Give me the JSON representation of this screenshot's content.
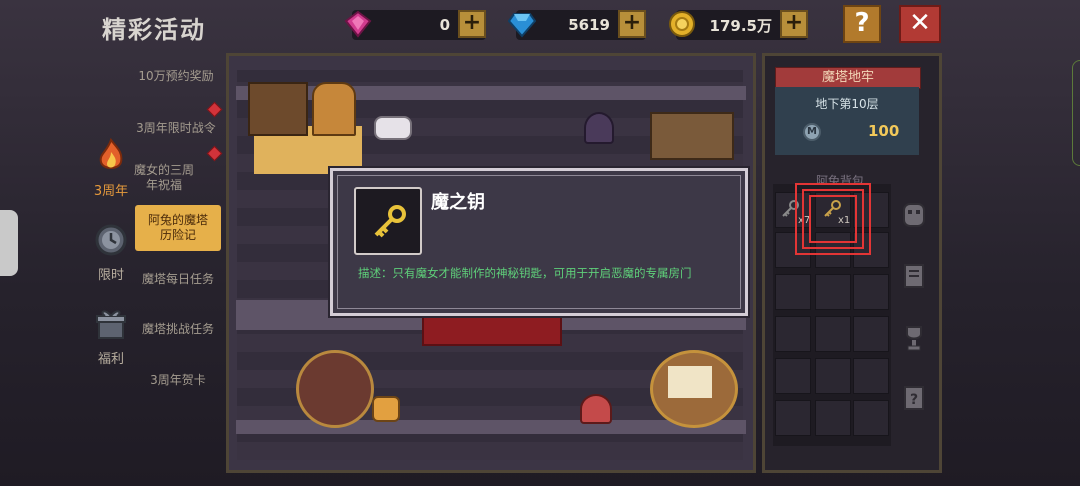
{
  "header": {
    "title": "精彩活动",
    "resources": [
      {
        "name": "pink-gem",
        "value": "0"
      },
      {
        "name": "blue-diamond",
        "value": "5619"
      },
      {
        "name": "gold-coin",
        "value": "179.5万"
      }
    ],
    "help_label": "?",
    "close_label": "✕"
  },
  "menu": {
    "items": [
      {
        "label": "10万预约奖励"
      },
      {
        "label": "3周年限时战令"
      },
      {
        "label": "魔女的三周年祝福"
      },
      {
        "label": "阿兔的魔塔历险记"
      },
      {
        "label": "魔塔每日任务"
      },
      {
        "label": "魔塔挑战任务"
      },
      {
        "label": "3周年贺卡"
      }
    ],
    "categories": [
      {
        "label": "3周年",
        "icon": "fire-icon"
      },
      {
        "label": "限时",
        "icon": "clock-icon"
      },
      {
        "label": "福利",
        "icon": "gift-icon"
      }
    ]
  },
  "panel": {
    "title": "魔塔地牢",
    "floor": "地下第10层",
    "coin_icon_label": "M",
    "coin_value": "100",
    "bag_label": "阿兔背包",
    "slots": [
      {
        "qty": "x7"
      },
      {
        "qty": "x1"
      }
    ]
  },
  "popup": {
    "item_name": "魔之钥",
    "description": "描述：只有魔女才能制作的神秘钥匙，可用于开启恶魔的专属房门"
  },
  "colors": {
    "accent_gold": "#e6b04a",
    "close_red": "#b23a34",
    "desc_green": "#5fd07a",
    "highlight_red": "#e33535"
  }
}
